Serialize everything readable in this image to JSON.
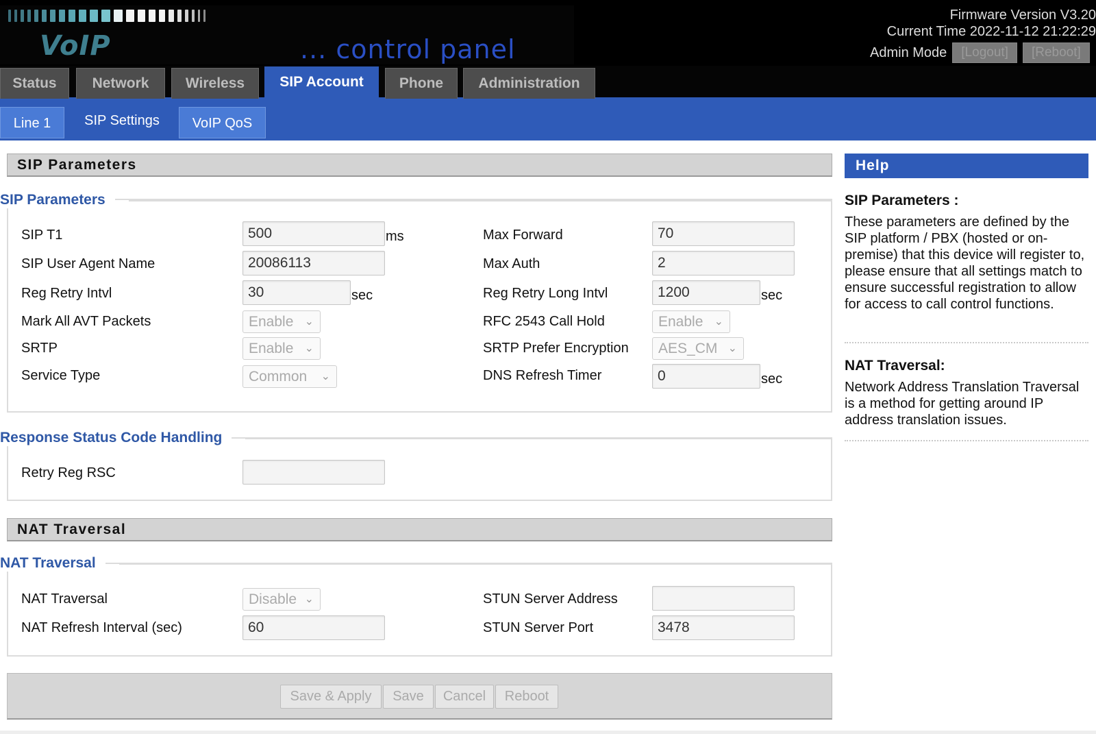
{
  "header": {
    "logo_voip": "VoIP",
    "logo_subtitle": "... control panel",
    "firmware": "Firmware Version V3.20",
    "current_time": "Current Time 2022-11-12 21:22:29",
    "admin_mode": "Admin Mode",
    "logout_label": "[Logout]",
    "reboot_label": "[Reboot]"
  },
  "main_tabs": [
    {
      "label": "Status"
    },
    {
      "label": "Network"
    },
    {
      "label": "Wireless"
    },
    {
      "label": "SIP Account",
      "active": true
    },
    {
      "label": "Phone"
    },
    {
      "label": "Administration"
    }
  ],
  "sub_tabs": [
    {
      "label": "Line 1"
    },
    {
      "label": "SIP Settings",
      "active": true
    },
    {
      "label": "VoIP QoS"
    }
  ],
  "sip_section": {
    "title": "SIP Parameters",
    "legend": "SIP Parameters",
    "fields": {
      "sip_t1": {
        "label": "SIP T1",
        "value": "500",
        "unit": "ms"
      },
      "user_agent": {
        "label": "SIP User Agent Name",
        "value": "20086113"
      },
      "reg_retry": {
        "label": "Reg Retry Intvl",
        "value": "30",
        "unit": "sec"
      },
      "mark_avt": {
        "label": "Mark All AVT Packets",
        "value": "Enable"
      },
      "srtp": {
        "label": "SRTP",
        "value": "Enable"
      },
      "service_type": {
        "label": "Service Type",
        "value": "Common"
      },
      "max_forward": {
        "label": "Max Forward",
        "value": "70"
      },
      "max_auth": {
        "label": "Max Auth",
        "value": "2"
      },
      "reg_retry_long": {
        "label": "Reg Retry Long Intvl",
        "value": "1200",
        "unit": "sec"
      },
      "rfc2543": {
        "label": "RFC 2543 Call Hold",
        "value": "Enable"
      },
      "srtp_enc": {
        "label": "SRTP Prefer Encryption",
        "value": "AES_CM"
      },
      "dns_refresh": {
        "label": "DNS Refresh Timer",
        "value": "0",
        "unit": "sec"
      }
    }
  },
  "rsc_section": {
    "legend": "Response Status Code Handling",
    "retry_reg_rsc": {
      "label": "Retry Reg RSC",
      "value": ""
    }
  },
  "nat_section": {
    "title": "NAT Traversal",
    "legend": "NAT Traversal",
    "fields": {
      "nat_traversal": {
        "label": "NAT Traversal",
        "value": "Disable"
      },
      "nat_refresh": {
        "label": "NAT Refresh Interval (sec)",
        "value": "60"
      },
      "stun_address": {
        "label": "STUN Server Address",
        "value": ""
      },
      "stun_port": {
        "label": "STUN Server Port",
        "value": "3478"
      }
    }
  },
  "buttons": {
    "save_apply": "Save & Apply",
    "save": "Save",
    "cancel": "Cancel",
    "reboot": "Reboot"
  },
  "help": {
    "title": "Help",
    "sip_heading": "SIP Parameters :",
    "sip_text": "These parameters are defined by the SIP platform / PBX (hosted or on-premise) that this device will register to, please ensure that all settings match to ensure successful registration to allow for access to call control functions.",
    "nat_heading": "NAT Traversal:",
    "nat_text": "Network Address Translation Traversal is a method for getting around IP address translation issues."
  },
  "colors": {
    "accent_blue": "#2f5bb8",
    "legend_blue": "#2f58a6",
    "header_black": "#000000",
    "section_gray": "#d3d3d3"
  }
}
